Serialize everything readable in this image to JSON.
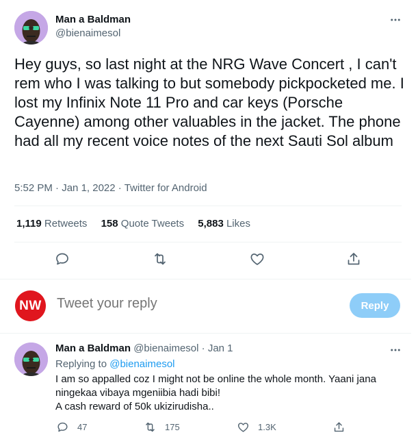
{
  "main_tweet": {
    "author_name": "Man a Baldman",
    "author_handle": "@bienaimesol",
    "text": "Hey guys, so last night at the NRG Wave Concert , I can't rem who I was talking to but somebody pickpocketed me. I lost my Infinix Note 11 Pro and car keys (Porsche Cayenne) among other valuables in the jacket. The phone had all my recent voice notes of the next Sauti Sol album",
    "time": "5:52 PM",
    "date": "Jan 1, 2022",
    "source": "Twitter for Android",
    "separator": "·",
    "retweets_count": "1,119",
    "retweets_label": "Retweets",
    "quotes_count": "158",
    "quotes_label": "Quote Tweets",
    "likes_count": "5,883",
    "likes_label": "Likes"
  },
  "reply_box": {
    "avatar_text": "NW",
    "placeholder": "Tweet your reply",
    "button_label": "Reply"
  },
  "reply_tweet": {
    "author_name": "Man a Baldman",
    "author_handle": "@bienaimesol",
    "separator": "·",
    "date": "Jan 1",
    "replying_label": "Replying to",
    "replying_to": "@bienaimesol",
    "line1": "I am so appalled coz I might not be online the whole month. Yaani jana ningekaa vibaya mgeniibia hadi bibi!",
    "line2": "A cash reward of 50k ukizirudisha..",
    "reply_count": "47",
    "retweet_count": "175",
    "like_count": "1.3K"
  },
  "colors": {
    "accent": "#1d9bf0",
    "reply_button": "#8ecdf8",
    "secondary_text": "#536471",
    "avatar_bg": "#c5a7e6",
    "nw_red": "#e0161e"
  }
}
